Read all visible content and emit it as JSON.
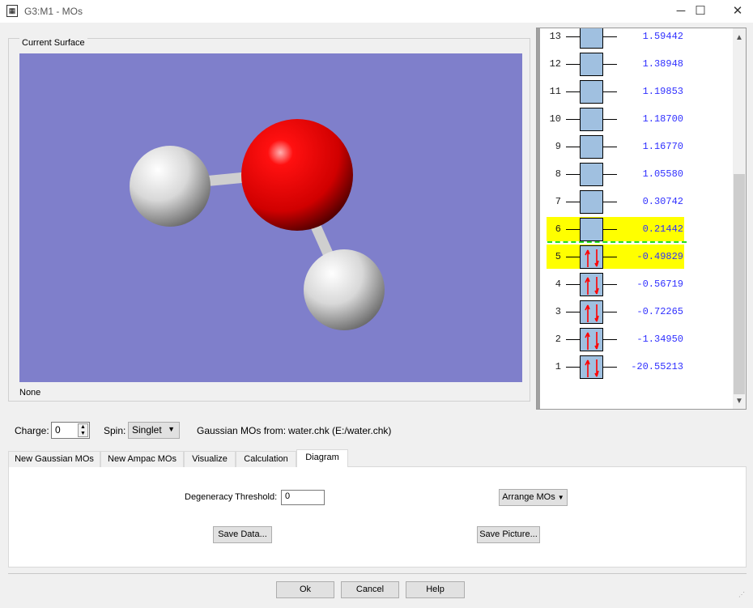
{
  "window": {
    "title": "G3:M1 - MOs",
    "icon": "app-icon",
    "controls": {
      "minimize": "─",
      "maximize": "☐",
      "close": "✕"
    }
  },
  "surface": {
    "group_label": "Current Surface",
    "current": "None",
    "background_color": "#7f7fcb",
    "molecule": {
      "atoms": [
        {
          "element": "H",
          "color": "#ffffff"
        },
        {
          "element": "O",
          "color": "#ff0000"
        },
        {
          "element": "H",
          "color": "#ffffff"
        }
      ]
    }
  },
  "diagram": {
    "levels": [
      {
        "n": "13",
        "energy": "1.59442",
        "occupied": false,
        "highlight": false
      },
      {
        "n": "12",
        "energy": "1.38948",
        "occupied": false,
        "highlight": false
      },
      {
        "n": "11",
        "energy": "1.19853",
        "occupied": false,
        "highlight": false
      },
      {
        "n": "10",
        "energy": "1.18700",
        "occupied": false,
        "highlight": false
      },
      {
        "n": "9",
        "energy": "1.16770",
        "occupied": false,
        "highlight": false
      },
      {
        "n": "8",
        "energy": "1.05580",
        "occupied": false,
        "highlight": false
      },
      {
        "n": "7",
        "energy": "0.30742",
        "occupied": false,
        "highlight": false
      },
      {
        "n": "6",
        "energy": "0.21442",
        "occupied": false,
        "highlight": true
      },
      {
        "n": "5",
        "energy": "-0.49829",
        "occupied": true,
        "highlight": true
      },
      {
        "n": "4",
        "energy": "-0.56719",
        "occupied": true,
        "highlight": false
      },
      {
        "n": "3",
        "energy": "-0.72265",
        "occupied": true,
        "highlight": false
      },
      {
        "n": "2",
        "energy": "-1.34950",
        "occupied": true,
        "highlight": false
      },
      {
        "n": "1",
        "energy": "-20.55213",
        "occupied": true,
        "highlight": false
      }
    ],
    "highlight_color": "#ffff00",
    "homo_lumo_line_color": "#22dd22",
    "electron_arrow_color": "#ff0000"
  },
  "controls": {
    "charge_label": "Charge:",
    "charge_value": "0",
    "spin_label": "Spin:",
    "spin_value": "Singlet",
    "source_label": "Gaussian MOs from:",
    "source_value": "water.chk (E:/water.chk)"
  },
  "tabs": [
    {
      "label": "New Gaussian MOs"
    },
    {
      "label": "New Ampac MOs"
    },
    {
      "label": "Visualize"
    },
    {
      "label": "Calculation"
    },
    {
      "label": "Diagram",
      "active": true
    }
  ],
  "diagram_tab": {
    "threshold_label": "Degeneracy Threshold:",
    "threshold_value": "0",
    "arrange_label": "Arrange MOs",
    "save_data": "Save Data...",
    "save_picture": "Save Picture..."
  },
  "footer": {
    "ok": "Ok",
    "cancel": "Cancel",
    "help": "Help"
  }
}
